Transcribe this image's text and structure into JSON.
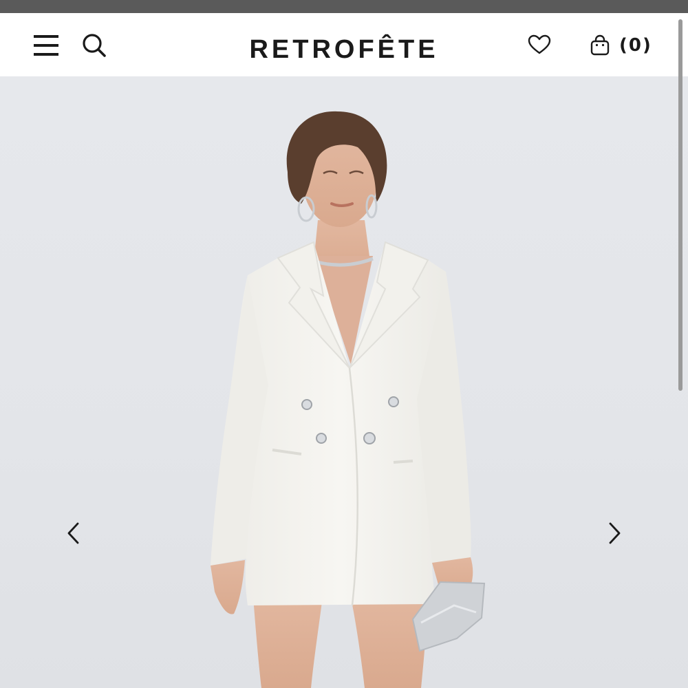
{
  "header": {
    "brand": "RETROFÊTE",
    "cart_count": "(0)",
    "icons": {
      "menu": "menu-icon",
      "search": "search-icon",
      "wishlist": "heart-icon",
      "cart": "shopping-bag-icon"
    }
  },
  "hero": {
    "image": "model-white-blazer-dress",
    "prev_icon": "chevron-left-icon",
    "next_icon": "chevron-right-icon"
  },
  "colors": {
    "text": "#1a1a1a",
    "background": "#e4e6ea",
    "blazer": "#f5f4f0"
  }
}
